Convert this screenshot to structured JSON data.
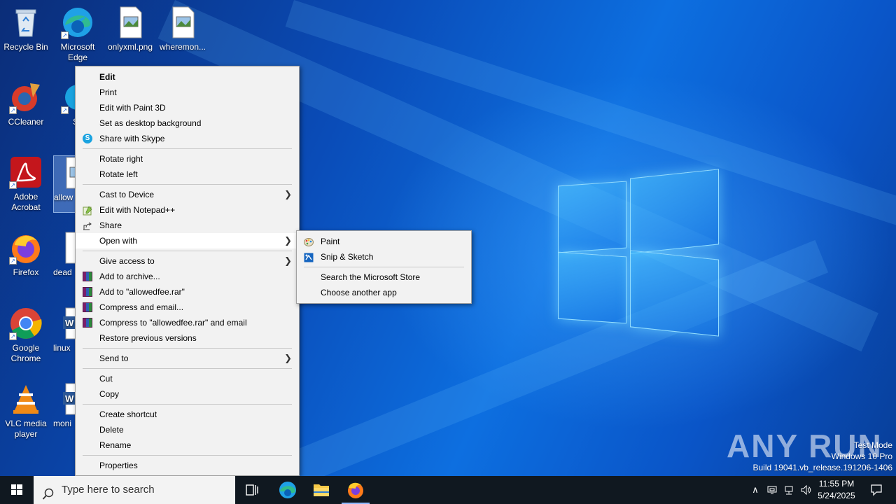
{
  "desktop_icons": [
    {
      "name": "recycle-bin",
      "label": "Recycle Bin"
    },
    {
      "name": "microsoft-edge",
      "label": "Microsoft Edge"
    },
    {
      "name": "onlyxml-png",
      "label": "onlyxml.png"
    },
    {
      "name": "wheremon",
      "label": "wheremon..."
    },
    {
      "name": "ccleaner",
      "label": "CCleaner"
    },
    {
      "name": "skype",
      "label": "Sk"
    },
    {
      "name": "adobe-acrobat",
      "label": "Adobe Acrobat"
    },
    {
      "name": "allowedfee",
      "label": "allow"
    },
    {
      "name": "firefox",
      "label": "Firefox"
    },
    {
      "name": "dead",
      "label": "dead"
    },
    {
      "name": "google-chrome",
      "label": "Google Chrome"
    },
    {
      "name": "linux",
      "label": "linux"
    },
    {
      "name": "vlc",
      "label": "VLC media player"
    },
    {
      "name": "moni",
      "label": "moni"
    }
  ],
  "context_menu": {
    "items": [
      {
        "label": "Edit"
      },
      {
        "label": "Print"
      },
      {
        "label": "Edit with Paint 3D"
      },
      {
        "label": "Set as desktop background"
      },
      {
        "label": "Share with Skype"
      },
      {
        "label": "Rotate right"
      },
      {
        "label": "Rotate left"
      },
      {
        "label": "Cast to Device"
      },
      {
        "label": "Edit with Notepad++"
      },
      {
        "label": "Share"
      },
      {
        "label": "Open with"
      },
      {
        "label": "Give access to"
      },
      {
        "label": "Add to archive..."
      },
      {
        "label": "Add to \"allowedfee.rar\""
      },
      {
        "label": "Compress and email..."
      },
      {
        "label": "Compress to \"allowedfee.rar\" and email"
      },
      {
        "label": "Restore previous versions"
      },
      {
        "label": "Send to"
      },
      {
        "label": "Cut"
      },
      {
        "label": "Copy"
      },
      {
        "label": "Create shortcut"
      },
      {
        "label": "Delete"
      },
      {
        "label": "Rename"
      },
      {
        "label": "Properties"
      }
    ]
  },
  "open_with_menu": {
    "items": [
      {
        "label": "Paint"
      },
      {
        "label": "Snip & Sketch"
      },
      {
        "label": "Search the Microsoft Store"
      },
      {
        "label": "Choose another app"
      }
    ]
  },
  "taskbar": {
    "search_placeholder": "Type here to search",
    "time": "11:55 PM",
    "date": "5/24/2025",
    "pinned": [
      "task-view",
      "microsoft-edge",
      "file-explorer",
      "firefox"
    ]
  },
  "watermark": {
    "logo": "ANY RUN",
    "line1": "Test Mode",
    "line2": "Windows 10 Pro",
    "line3": "Build 19041.vb_release.191206-1406"
  },
  "colors": {
    "menu_bg": "#f2f2f2",
    "menu_highlight": "#ffffff",
    "taskbar_bg": "#101820",
    "wallpaper_accent": "#0d6fe0"
  }
}
